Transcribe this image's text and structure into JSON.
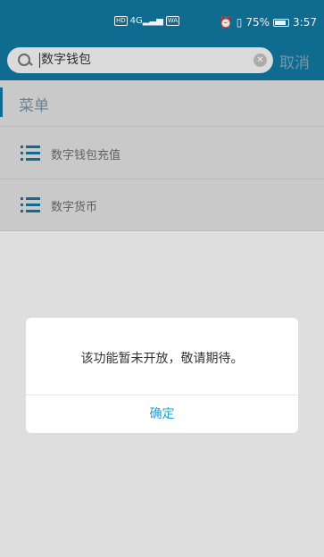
{
  "status_bar": {
    "hd_badge": "HD",
    "network": "4G",
    "signal_icon": "signal-bars-icon",
    "app_badge": "WA",
    "alarm_icon": "alarm-clock-icon",
    "vibrate_icon": "vibrate-icon",
    "battery_text": "75%",
    "battery_level": 0.75,
    "time": "3:57"
  },
  "search": {
    "value": "数字钱包",
    "clear_icon": "clear-icon",
    "cancel_label": "取消"
  },
  "menu": {
    "title": "菜单",
    "items": [
      {
        "label": "数字钱包充值",
        "icon": "list-icon"
      },
      {
        "label": "数字货币",
        "icon": "list-icon"
      }
    ]
  },
  "dialog": {
    "message": "该功能暂未开放，敬请期待。",
    "confirm_label": "确定"
  },
  "colors": {
    "primary": "#10739a",
    "accent_link": "#22a0cf"
  }
}
